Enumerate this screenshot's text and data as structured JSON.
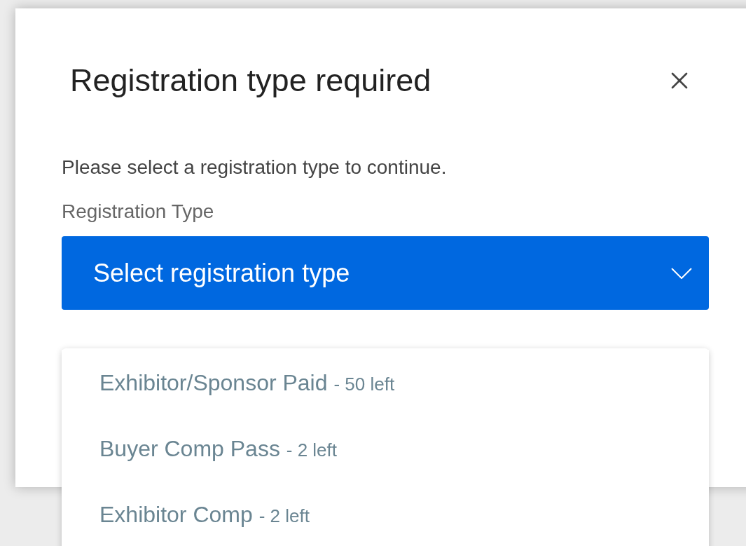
{
  "dialog": {
    "title": "Registration type required",
    "description": "Please select a registration type to continue.",
    "field_label": "Registration Type",
    "select": {
      "placeholder": "Select registration type",
      "expanded": true,
      "options": [
        {
          "label": "Exhibitor/Sponsor Paid",
          "remaining": "- 50 left",
          "selected": false
        },
        {
          "label": "Buyer Comp Pass",
          "remaining": "- 2 left",
          "selected": false
        },
        {
          "label": "Exhibitor Comp",
          "remaining": "- 2 left",
          "selected": false
        }
      ]
    }
  }
}
